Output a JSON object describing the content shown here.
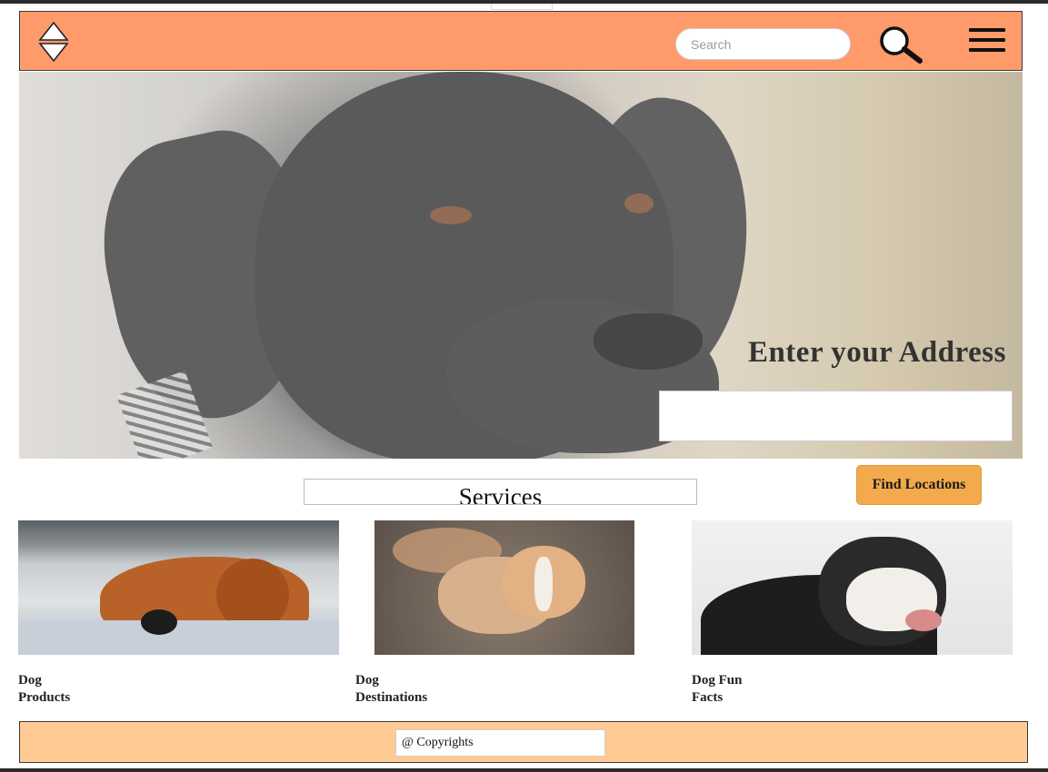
{
  "header": {
    "search": {
      "placeholder": "Search"
    }
  },
  "hero": {
    "title": "Enter your Address",
    "address_value": ""
  },
  "services": {
    "title": "Services",
    "find_button": "Find Locations"
  },
  "cards": [
    {
      "line1": "Dog",
      "line2": "Products"
    },
    {
      "line1": "Dog",
      "line2": "Destinations"
    },
    {
      "line1": "Dog Fun",
      "line2": "Facts"
    }
  ],
  "footer": {
    "copyright": "@ Copyrights"
  },
  "colors": {
    "header_bg": "#ff9b6b",
    "footer_bg": "#ffca93",
    "button_bg": "#f2aa4c"
  },
  "icons": [
    "logo-icon",
    "search-icon",
    "menu-icon"
  ]
}
